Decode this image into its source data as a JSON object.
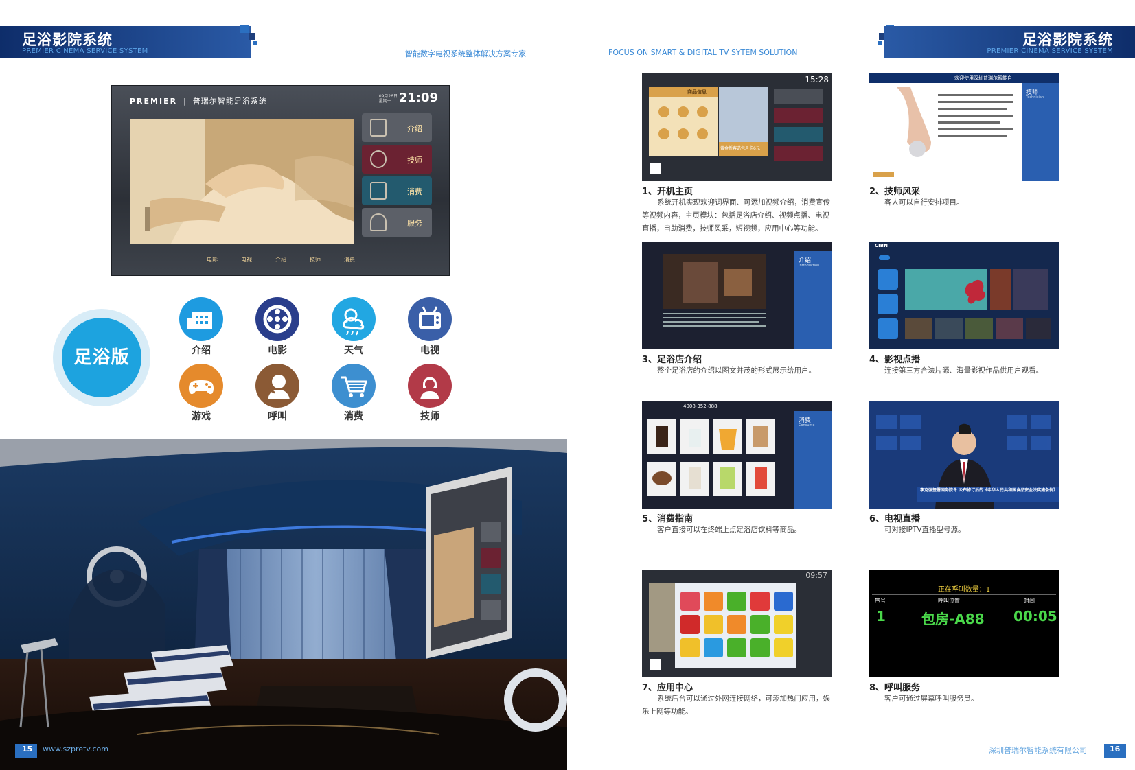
{
  "header": {
    "left_title": "足浴影院系统",
    "left_subtitle": "PREMIER CINEMA SERVICE SYSTEM",
    "left_tagline": "智能数字电视系统整体解决方案专家",
    "right_tagline": "FOCUS ON SMART & DIGITAL TV SYTEM SOLUTION",
    "right_title": "足浴影院系统",
    "right_subtitle": "PREMIER CINEMA SERVICE SYSTEM"
  },
  "tv": {
    "brand": "PREMIER",
    "system_name": "普瑞尔智能足浴系统",
    "date": "09月26日",
    "weekday": "星期一",
    "time": "21:09",
    "menu": [
      "介绍",
      "技师",
      "消费",
      "服务"
    ],
    "nav": [
      "电影",
      "电视",
      "介绍",
      "技师",
      "消费"
    ]
  },
  "edition_badge": "足浴版",
  "icons": [
    {
      "label": "介绍",
      "icon": "building-icon",
      "color": "#1e9be0"
    },
    {
      "label": "电影",
      "icon": "film-reel-icon",
      "color": "#2a3e8c"
    },
    {
      "label": "天气",
      "icon": "weather-icon",
      "color": "#22a7e2"
    },
    {
      "label": "电视",
      "icon": "tv-icon",
      "color": "#3a5fa8"
    },
    {
      "label": "游戏",
      "icon": "gamepad-icon",
      "color": "#e58a2c"
    },
    {
      "label": "呼叫",
      "icon": "call-icon",
      "color": "#8b5a35"
    },
    {
      "label": "消费",
      "icon": "cart-icon",
      "color": "#3d8fd0"
    },
    {
      "label": "技师",
      "icon": "technician-icon",
      "color": "#b23a48"
    }
  ],
  "features": [
    {
      "title": "1、开机主页",
      "body": "系统开机实现欢迎词界面、可添加视频介绍，消费宣传等视频内容，主页模块：包括足浴店介绍、视频点播、电视直播，自助消费，技师风采，短视频，应用中心等功能。",
      "screen": {
        "time": "15:28",
        "panel": "商品信息",
        "promo": "黄金新客选包月卡6元"
      }
    },
    {
      "title": "2、技师风采",
      "body": "客人可以自行安排项目。",
      "screen": {
        "welcome": "欢迎使用深圳普瑞尔智能自",
        "side": "技师",
        "side_en": "Technician"
      }
    },
    {
      "title": "3、足浴店介绍",
      "body": "整个足浴店的介绍以图文并茂的形式展示给用户。",
      "screen": {
        "side": "介绍",
        "side_en": "Introduction"
      }
    },
    {
      "title": "4、影视点播",
      "body": "连接第三方合法片源、海量影视作品供用户观看。",
      "screen": {
        "brand": "CIBN"
      }
    },
    {
      "title": "5、消费指南",
      "body": "客户直接可以在终端上点足浴店饮料等商品。",
      "screen": {
        "phone": "4008-352-888",
        "side": "消费",
        "side_en": "Consume"
      }
    },
    {
      "title": "6、电视直播",
      "body": "可对接IPTV直播型号源。",
      "screen": {
        "ticker": "李克强签署国务院令 公布修订后的《中华人民共和国食品安全法实施条例》"
      }
    },
    {
      "title": "7、应用中心",
      "body": "系统后台可以通过外网连接网络，可添加热门应用，娱乐上网等功能。",
      "screen": {
        "time": "09:57"
      }
    },
    {
      "title": "8、呼叫服务",
      "body": "客户可通过屏幕呼叫服务员。",
      "screen": {
        "calling": "正在呼叫数量：1",
        "col_no": "序号",
        "col_pos": "呼叫位置",
        "col_time": "时间",
        "row_no": "1",
        "row_pos": "包房-A88",
        "row_time": "00:05"
      }
    }
  ],
  "footer": {
    "left_page": "15",
    "website": "www.szpretv.com",
    "company": "深圳普瑞尔智能系统有限公司",
    "right_page": "16"
  }
}
